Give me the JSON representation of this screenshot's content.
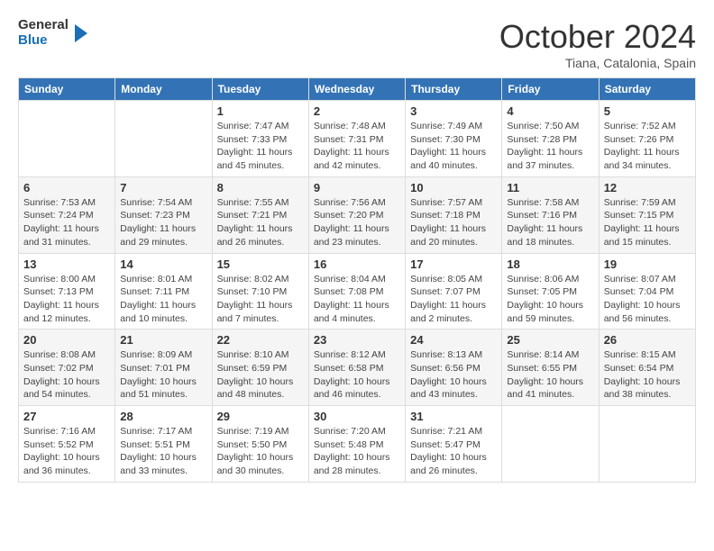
{
  "header": {
    "logo_general": "General",
    "logo_blue": "Blue",
    "month_title": "October 2024",
    "location": "Tiana, Catalonia, Spain"
  },
  "weekdays": [
    "Sunday",
    "Monday",
    "Tuesday",
    "Wednesday",
    "Thursday",
    "Friday",
    "Saturday"
  ],
  "weeks": [
    [
      {
        "day": "",
        "sunrise": "",
        "sunset": "",
        "daylight": ""
      },
      {
        "day": "",
        "sunrise": "",
        "sunset": "",
        "daylight": ""
      },
      {
        "day": "1",
        "sunrise": "Sunrise: 7:47 AM",
        "sunset": "Sunset: 7:33 PM",
        "daylight": "Daylight: 11 hours and 45 minutes."
      },
      {
        "day": "2",
        "sunrise": "Sunrise: 7:48 AM",
        "sunset": "Sunset: 7:31 PM",
        "daylight": "Daylight: 11 hours and 42 minutes."
      },
      {
        "day": "3",
        "sunrise": "Sunrise: 7:49 AM",
        "sunset": "Sunset: 7:30 PM",
        "daylight": "Daylight: 11 hours and 40 minutes."
      },
      {
        "day": "4",
        "sunrise": "Sunrise: 7:50 AM",
        "sunset": "Sunset: 7:28 PM",
        "daylight": "Daylight: 11 hours and 37 minutes."
      },
      {
        "day": "5",
        "sunrise": "Sunrise: 7:52 AM",
        "sunset": "Sunset: 7:26 PM",
        "daylight": "Daylight: 11 hours and 34 minutes."
      }
    ],
    [
      {
        "day": "6",
        "sunrise": "Sunrise: 7:53 AM",
        "sunset": "Sunset: 7:24 PM",
        "daylight": "Daylight: 11 hours and 31 minutes."
      },
      {
        "day": "7",
        "sunrise": "Sunrise: 7:54 AM",
        "sunset": "Sunset: 7:23 PM",
        "daylight": "Daylight: 11 hours and 29 minutes."
      },
      {
        "day": "8",
        "sunrise": "Sunrise: 7:55 AM",
        "sunset": "Sunset: 7:21 PM",
        "daylight": "Daylight: 11 hours and 26 minutes."
      },
      {
        "day": "9",
        "sunrise": "Sunrise: 7:56 AM",
        "sunset": "Sunset: 7:20 PM",
        "daylight": "Daylight: 11 hours and 23 minutes."
      },
      {
        "day": "10",
        "sunrise": "Sunrise: 7:57 AM",
        "sunset": "Sunset: 7:18 PM",
        "daylight": "Daylight: 11 hours and 20 minutes."
      },
      {
        "day": "11",
        "sunrise": "Sunrise: 7:58 AM",
        "sunset": "Sunset: 7:16 PM",
        "daylight": "Daylight: 11 hours and 18 minutes."
      },
      {
        "day": "12",
        "sunrise": "Sunrise: 7:59 AM",
        "sunset": "Sunset: 7:15 PM",
        "daylight": "Daylight: 11 hours and 15 minutes."
      }
    ],
    [
      {
        "day": "13",
        "sunrise": "Sunrise: 8:00 AM",
        "sunset": "Sunset: 7:13 PM",
        "daylight": "Daylight: 11 hours and 12 minutes."
      },
      {
        "day": "14",
        "sunrise": "Sunrise: 8:01 AM",
        "sunset": "Sunset: 7:11 PM",
        "daylight": "Daylight: 11 hours and 10 minutes."
      },
      {
        "day": "15",
        "sunrise": "Sunrise: 8:02 AM",
        "sunset": "Sunset: 7:10 PM",
        "daylight": "Daylight: 11 hours and 7 minutes."
      },
      {
        "day": "16",
        "sunrise": "Sunrise: 8:04 AM",
        "sunset": "Sunset: 7:08 PM",
        "daylight": "Daylight: 11 hours and 4 minutes."
      },
      {
        "day": "17",
        "sunrise": "Sunrise: 8:05 AM",
        "sunset": "Sunset: 7:07 PM",
        "daylight": "Daylight: 11 hours and 2 minutes."
      },
      {
        "day": "18",
        "sunrise": "Sunrise: 8:06 AM",
        "sunset": "Sunset: 7:05 PM",
        "daylight": "Daylight: 10 hours and 59 minutes."
      },
      {
        "day": "19",
        "sunrise": "Sunrise: 8:07 AM",
        "sunset": "Sunset: 7:04 PM",
        "daylight": "Daylight: 10 hours and 56 minutes."
      }
    ],
    [
      {
        "day": "20",
        "sunrise": "Sunrise: 8:08 AM",
        "sunset": "Sunset: 7:02 PM",
        "daylight": "Daylight: 10 hours and 54 minutes."
      },
      {
        "day": "21",
        "sunrise": "Sunrise: 8:09 AM",
        "sunset": "Sunset: 7:01 PM",
        "daylight": "Daylight: 10 hours and 51 minutes."
      },
      {
        "day": "22",
        "sunrise": "Sunrise: 8:10 AM",
        "sunset": "Sunset: 6:59 PM",
        "daylight": "Daylight: 10 hours and 48 minutes."
      },
      {
        "day": "23",
        "sunrise": "Sunrise: 8:12 AM",
        "sunset": "Sunset: 6:58 PM",
        "daylight": "Daylight: 10 hours and 46 minutes."
      },
      {
        "day": "24",
        "sunrise": "Sunrise: 8:13 AM",
        "sunset": "Sunset: 6:56 PM",
        "daylight": "Daylight: 10 hours and 43 minutes."
      },
      {
        "day": "25",
        "sunrise": "Sunrise: 8:14 AM",
        "sunset": "Sunset: 6:55 PM",
        "daylight": "Daylight: 10 hours and 41 minutes."
      },
      {
        "day": "26",
        "sunrise": "Sunrise: 8:15 AM",
        "sunset": "Sunset: 6:54 PM",
        "daylight": "Daylight: 10 hours and 38 minutes."
      }
    ],
    [
      {
        "day": "27",
        "sunrise": "Sunrise: 7:16 AM",
        "sunset": "Sunset: 5:52 PM",
        "daylight": "Daylight: 10 hours and 36 minutes."
      },
      {
        "day": "28",
        "sunrise": "Sunrise: 7:17 AM",
        "sunset": "Sunset: 5:51 PM",
        "daylight": "Daylight: 10 hours and 33 minutes."
      },
      {
        "day": "29",
        "sunrise": "Sunrise: 7:19 AM",
        "sunset": "Sunset: 5:50 PM",
        "daylight": "Daylight: 10 hours and 30 minutes."
      },
      {
        "day": "30",
        "sunrise": "Sunrise: 7:20 AM",
        "sunset": "Sunset: 5:48 PM",
        "daylight": "Daylight: 10 hours and 28 minutes."
      },
      {
        "day": "31",
        "sunrise": "Sunrise: 7:21 AM",
        "sunset": "Sunset: 5:47 PM",
        "daylight": "Daylight: 10 hours and 26 minutes."
      },
      {
        "day": "",
        "sunrise": "",
        "sunset": "",
        "daylight": ""
      },
      {
        "day": "",
        "sunrise": "",
        "sunset": "",
        "daylight": ""
      }
    ]
  ]
}
